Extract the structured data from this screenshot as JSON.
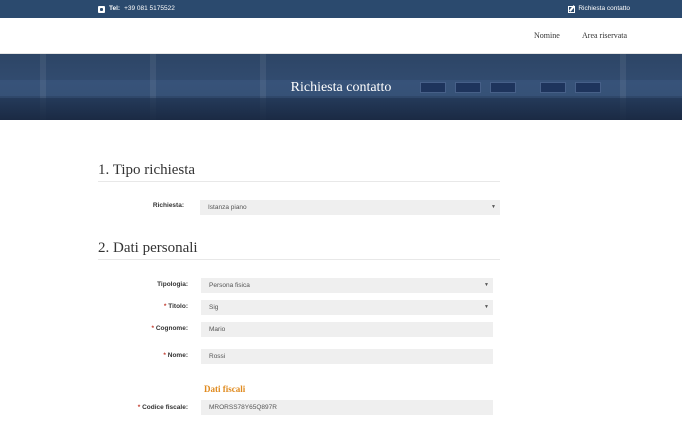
{
  "topbar": {
    "phone_prefix": "Tel:",
    "phone_number": "+39 081 5175522",
    "contact_link": "Richiesta contatto"
  },
  "nav": {
    "items": [
      "Nomine",
      "Area riservata"
    ]
  },
  "hero": {
    "title": "Richiesta contatto"
  },
  "section1": {
    "title": "1. Tipo richiesta",
    "richiesta_label": "Richiesta:",
    "richiesta_value": "Istanza piano"
  },
  "section2": {
    "title": "2. Dati personali",
    "tipologia_label": "Tipologia:",
    "tipologia_value": "Persona fisica",
    "titolo_label": "Titolo:",
    "titolo_value": "Sig",
    "cognome_label": "Cognome:",
    "cognome_value": "Mario",
    "nome_label": "Nome:",
    "nome_value": "Rossi",
    "fiscali_heading": "Dati fiscali",
    "codice_label": "Codice fiscale:",
    "codice_value": "MRORSS78Y65Q897R"
  },
  "colors": {
    "topbar_bg": "#2b4a6e",
    "accent_orange": "#e08a1e",
    "required_red": "#c0392b",
    "field_bg": "#efefef"
  }
}
